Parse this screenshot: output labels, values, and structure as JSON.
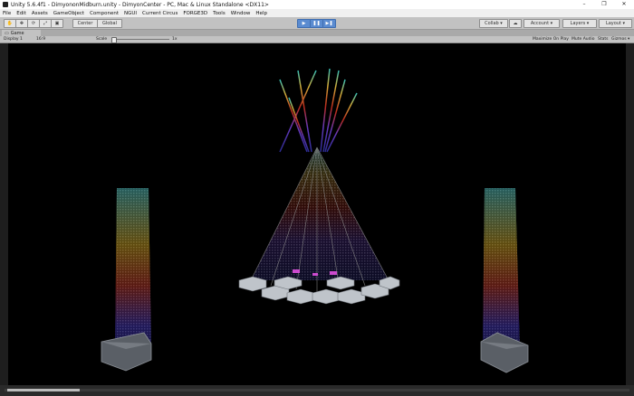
{
  "window": {
    "title": "Unity 5.6.4f1 - DimyononMidburn.unity - DimyonCenter - PC, Mac & Linux Standalone <DX11>",
    "minimize": "–",
    "maximize": "❐",
    "close": "✕"
  },
  "menu": [
    "File",
    "Edit",
    "Assets",
    "GameObject",
    "Component",
    "NGUI",
    "Current Circus",
    "FORGE3D",
    "Tools",
    "Window",
    "Help"
  ],
  "toolbar": {
    "pivot_center": "Center",
    "pivot_global": "Global",
    "collab": "Collab ▾",
    "account": "Account ▾",
    "layers": "Layers ▾",
    "layout": "Layout ▾"
  },
  "tab": {
    "label": "Game"
  },
  "gamebar": {
    "display": "Display 1",
    "aspect": "16:9",
    "scale_label": "Scale",
    "scale_value": "1x",
    "maximize": "Maximize On Play",
    "mute": "Mute Audio",
    "stats": "Stats",
    "gizmos": "Gizmos ▾"
  },
  "colors": {
    "accent_play": "#5a8bd0",
    "toolbar_bg": "#c2c2c2",
    "viewport_bg": "#000000"
  }
}
